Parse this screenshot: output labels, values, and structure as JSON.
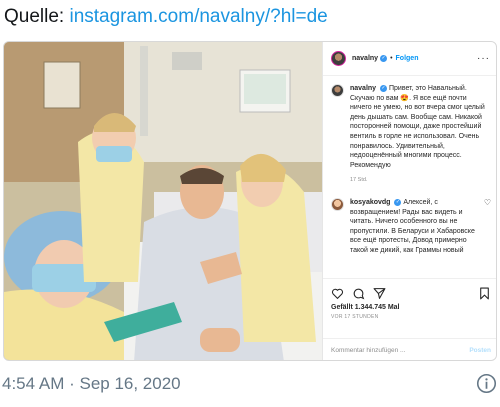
{
  "source": {
    "label": "Quelle: ",
    "link": "instagram.com/navalny/?hl=de"
  },
  "post": {
    "header": {
      "username": "navalny",
      "follow_label": "Folgen",
      "more_icon": "more-icon"
    },
    "caption": {
      "username": "navalny",
      "text": "Привет, это Навальный. Скучаю по вам 😍. Я все ещё почти ничего не умею, но вот вчера смог целый день дышать сам. Вообще сам. Никакой посторонней помощи, даже простейший вентиль в горле не использовал. Очень понравилось. Удивительный, недооценённый многими процесс. Рекомендую",
      "time": "17 Std."
    },
    "comment": {
      "username": "kosyakovdg",
      "text": "Алексей, с возвращением! Рады вас видеть и читать. Ничего особенного вы не пропустили. В Беларуси и Хабаровске все ещё протесты, Довод примерно такой же дикий, как Граммы новый"
    },
    "likes": "Gefällt 1.344.745 Mal",
    "post_time": "VOR 17 STUNDEN",
    "add_comment_placeholder": "Kommentar hinzufügen ...",
    "post_button": "Posten",
    "icons": [
      "heart-icon",
      "comment-icon",
      "share-icon",
      "bookmark-icon"
    ]
  },
  "tweet": {
    "timestamp": "4:54 AM · Sep 16, 2020"
  },
  "colors": {
    "link": "#1b95e0",
    "follow": "#0095f6",
    "muted": "#8e8e8e",
    "timestamp": "#657786"
  }
}
